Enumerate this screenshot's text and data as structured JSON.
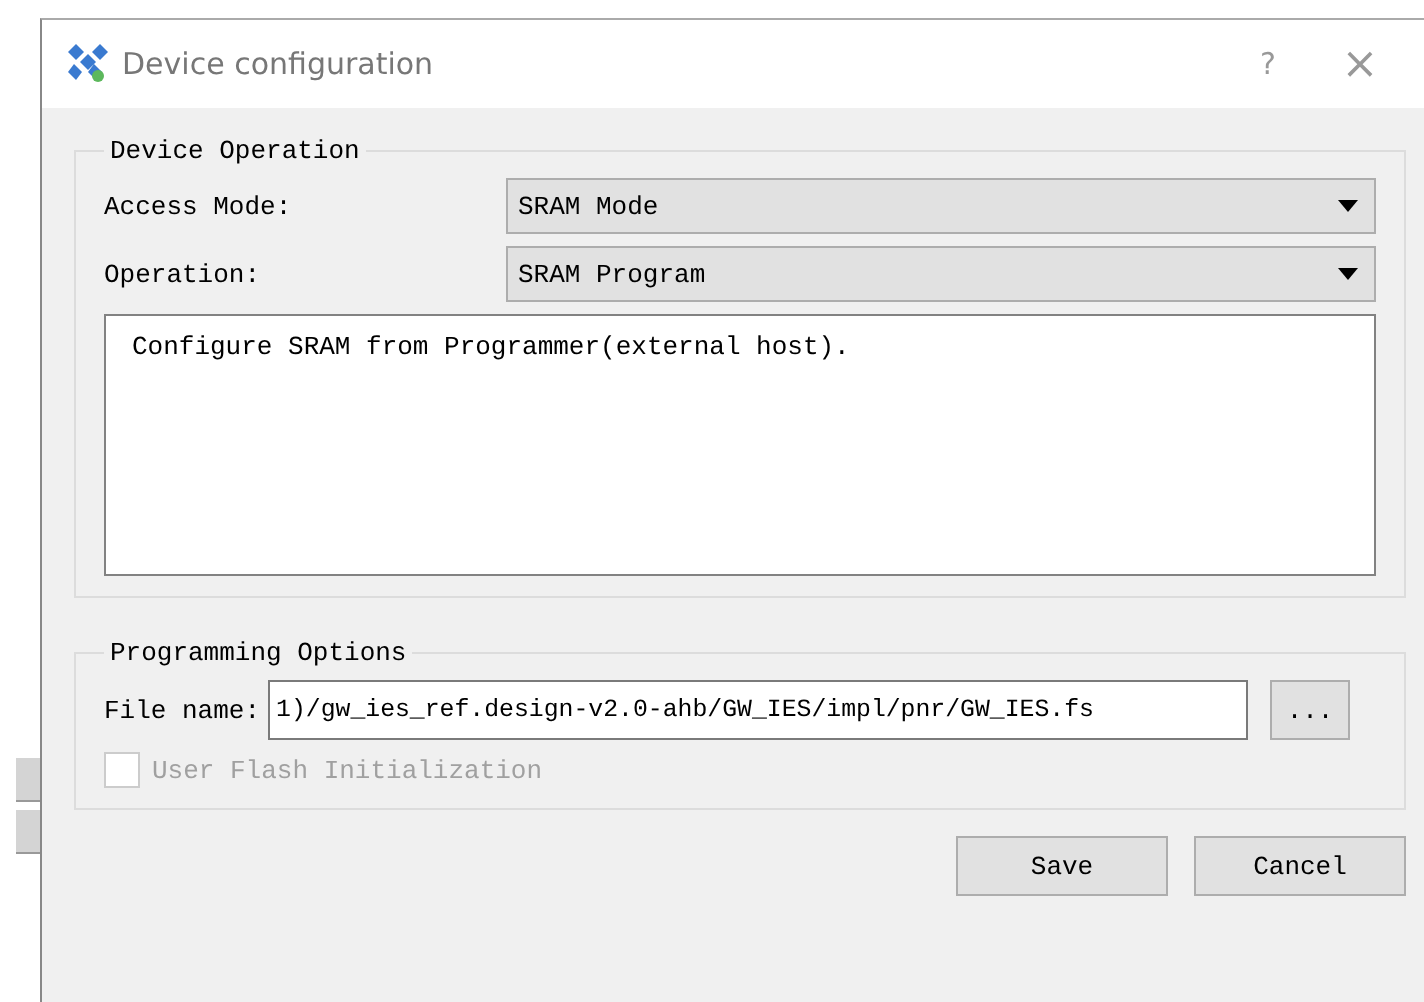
{
  "window": {
    "title": "Device configuration",
    "help": "?",
    "close": "×"
  },
  "device_operation": {
    "title": "Device Operation",
    "fields": [
      {
        "label": "Access Mode:",
        "value": "SRAM Mode"
      },
      {
        "label": "Operation:",
        "value": "SRAM Program"
      }
    ],
    "description": "Configure SRAM from Programmer(external host)."
  },
  "programming_options": {
    "title": "Programming Options",
    "file_label": "File name:",
    "file_value": "1)/gw_ies_ref.design-v2.0-ahb/GW_IES/impl/pnr/GW_IES.fs",
    "browse": "...",
    "user_flash": {
      "label": "User Flash Initialization",
      "checked": false,
      "disabled": true
    }
  },
  "buttons": [
    "Save",
    "Cancel"
  ]
}
